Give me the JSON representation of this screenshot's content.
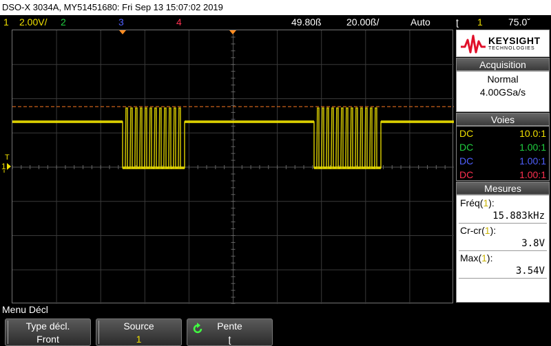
{
  "titlebar": {
    "text": "DSO-X 3034A, MY51451680: Fri Sep 13 15:07:02 2019"
  },
  "status": {
    "ch1_num": "1",
    "ch1_scale": "2.00V/",
    "ch2_num": "2",
    "ch3_num": "3",
    "ch4_num": "4",
    "time_offset": "49.80ß",
    "time_scale": "20.00ß/",
    "trigger_mode": "Auto",
    "trig_icon": "ʈ",
    "trig_ch": "1",
    "trig_level": "75.0ˇ",
    "colors": {
      "ch1": "#f0e000",
      "ch2": "#20d040",
      "ch3": "#5060ff",
      "ch4": "#ff3050"
    }
  },
  "left_markers": {
    "trigger_label": "T",
    "ch1_marker": "1"
  },
  "logo": {
    "brand": "KEYSIGHT",
    "tagline": "TECHNOLOGIES"
  },
  "acquisition": {
    "title": "Acquisition",
    "mode": "Normal",
    "rate": "4.00GSa/s"
  },
  "channels": {
    "title": "Voies",
    "rows": [
      {
        "coupling": "DC",
        "probe": "10.0:1",
        "color": "#f0e000"
      },
      {
        "coupling": "DC",
        "probe": "1.00:1",
        "color": "#20d040"
      },
      {
        "coupling": "DC",
        "probe": "1.00:1",
        "color": "#5060ff"
      },
      {
        "coupling": "DC",
        "probe": "1.00:1",
        "color": "#ff3050"
      }
    ]
  },
  "measures": {
    "title": "Mesures",
    "freq_label": "Fréq(",
    "freq_ch": "1",
    "freq_close": "):",
    "freq_value": "15.883kHz",
    "pp_label": "Cr-cr(",
    "pp_ch": "1",
    "pp_close": "):",
    "pp_value": "3.8V",
    "max_label": "Max(",
    "max_ch": "1",
    "max_close": "):",
    "max_value": "3.54V"
  },
  "menu": {
    "title": "Menu Décl"
  },
  "softkeys": [
    {
      "label": "Type décl.",
      "value": "Front"
    },
    {
      "label": "Source",
      "value": "1"
    },
    {
      "label": "Pente",
      "value": "ʈ"
    }
  ]
}
